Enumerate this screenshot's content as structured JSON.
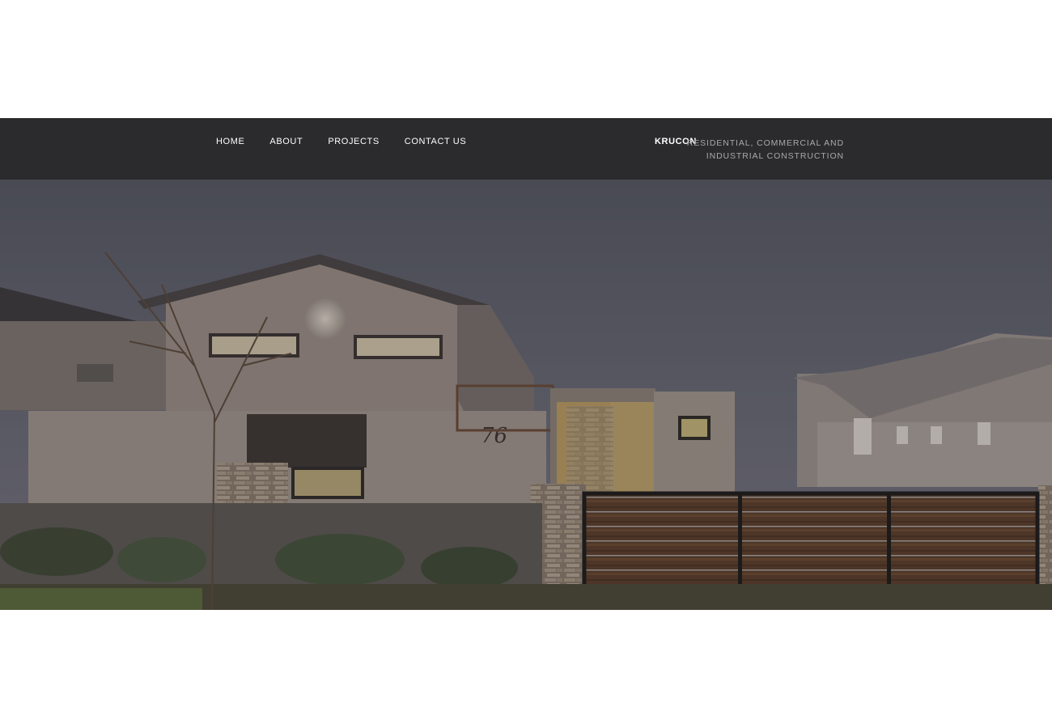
{
  "nav": {
    "links": [
      {
        "label": "HOME"
      },
      {
        "label": "ABOUT"
      },
      {
        "label": "PROJECTS"
      },
      {
        "label": "CONTACT US"
      }
    ]
  },
  "brand": {
    "name": "KRUCON",
    "tagline": "RESIDENTIAL, COMMERCIAL AND INDUSTRIAL CONSTRUCTION"
  },
  "hero": {
    "house_number": "76"
  },
  "colors": {
    "navbar_bg": "#2b2b2d",
    "nav_text": "#ffffff",
    "tagline_text": "#a9a9ab",
    "page_bg": "#ffffff"
  }
}
